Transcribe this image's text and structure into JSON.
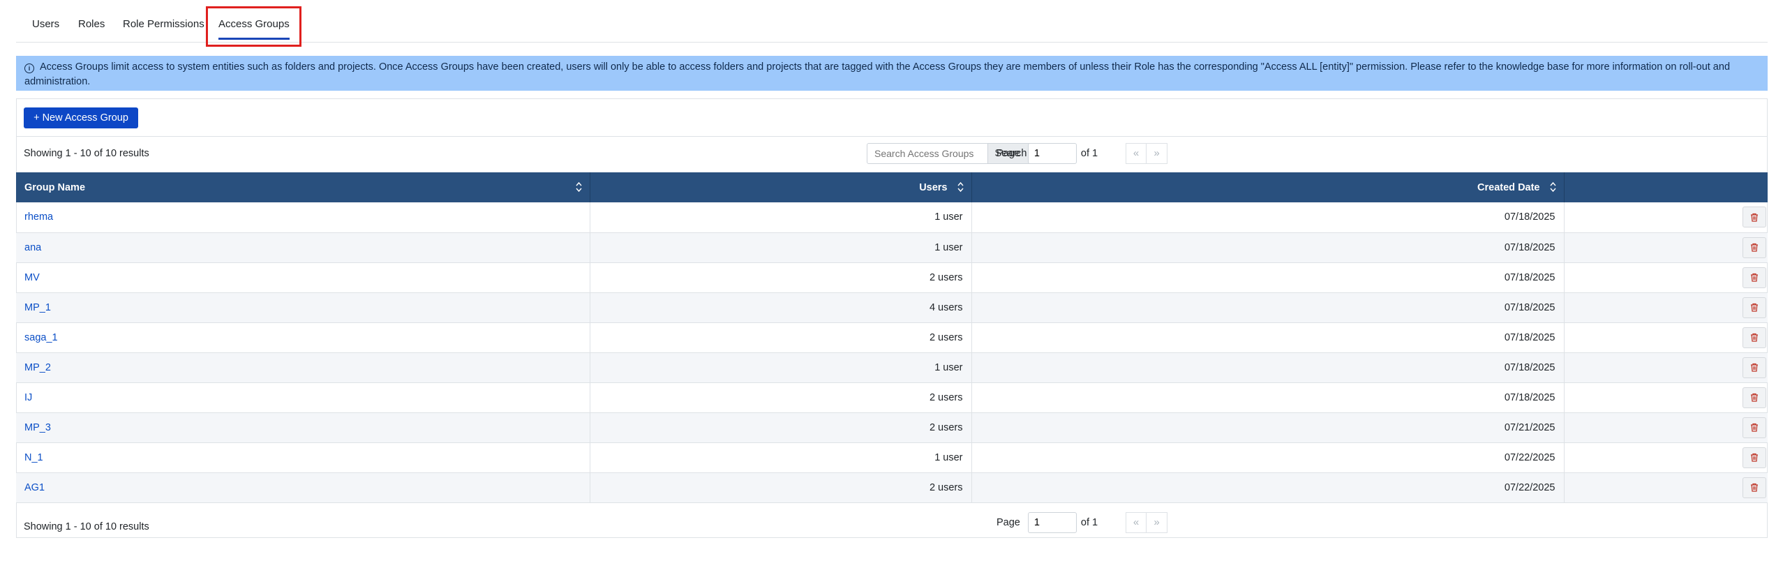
{
  "tabs": [
    {
      "label": "Users",
      "active": false
    },
    {
      "label": "Roles",
      "active": false
    },
    {
      "label": "Role Permissions",
      "active": false
    },
    {
      "label": "Access Groups",
      "active": true
    }
  ],
  "banner": {
    "icon": "info-circle-icon",
    "line1": "Access Groups limit access to system entities such as folders and projects. Once Access Groups have been created, users will only be able to access folders and projects that are tagged with the Access Groups they are members of unless their Role has the corresponding \"Access ALL [entity]\" permission. Please refer to the knowledge base for more information on roll-out and",
    "line2": "administration."
  },
  "toolbar": {
    "new_button": "+ New Access Group"
  },
  "top": {
    "showing": "Showing 1 - 10 of 10 results",
    "search_placeholder": "Search Access Groups",
    "search_button": "Search",
    "page_label": "Page",
    "page_value": "1",
    "of_label": "of 1",
    "prev": "«",
    "next": "»"
  },
  "bottom": {
    "showing": "Showing 1 - 10 of 10 results",
    "page_label": "Page",
    "page_value": "1",
    "of_label": "of 1",
    "prev": "«",
    "next": "»"
  },
  "table": {
    "headers": [
      "Group Name",
      "Users",
      "Created Date",
      ""
    ],
    "rows": [
      {
        "name": "rhema",
        "users": "1 user",
        "date": "07/18/2025"
      },
      {
        "name": "ana",
        "users": "1 user",
        "date": "07/18/2025"
      },
      {
        "name": "MV",
        "users": "2 users",
        "date": "07/18/2025"
      },
      {
        "name": "MP_1",
        "users": "4 users",
        "date": "07/18/2025"
      },
      {
        "name": "saga_1",
        "users": "2 users",
        "date": "07/18/2025"
      },
      {
        "name": "MP_2",
        "users": "1 user",
        "date": "07/18/2025"
      },
      {
        "name": "IJ",
        "users": "2 users",
        "date": "07/18/2025"
      },
      {
        "name": "MP_3",
        "users": "2 users",
        "date": "07/21/2025"
      },
      {
        "name": "N_1",
        "users": "1 user",
        "date": "07/22/2025"
      },
      {
        "name": "AG1",
        "users": "2 users",
        "date": "07/22/2025"
      }
    ]
  },
  "colors": {
    "primary": "#0d47c6",
    "header_bg": "#29507e",
    "banner_bg": "#9dc8fb",
    "link": "#0b4fc7",
    "highlight": "#e0201e",
    "delete_icon": "#c0392b"
  }
}
